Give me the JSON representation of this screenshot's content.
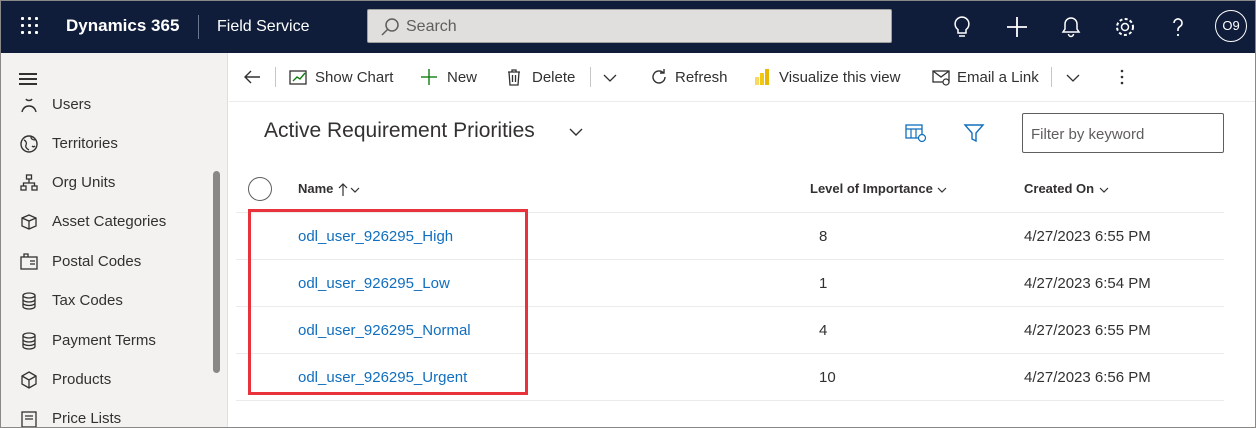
{
  "topbar": {
    "brand": "Dynamics 365",
    "app_name": "Field Service",
    "search_placeholder": "Search",
    "avatar_initials": "O9"
  },
  "sidebar": {
    "items": [
      {
        "label": "Users",
        "icon": "users-icon"
      },
      {
        "label": "Territories",
        "icon": "globe-icon"
      },
      {
        "label": "Org Units",
        "icon": "org-units-icon"
      },
      {
        "label": "Asset Categories",
        "icon": "asset-categories-icon"
      },
      {
        "label": "Postal Codes",
        "icon": "postal-codes-icon"
      },
      {
        "label": "Tax Codes",
        "icon": "database-icon"
      },
      {
        "label": "Payment Terms",
        "icon": "database-icon"
      },
      {
        "label": "Products",
        "icon": "cube-icon"
      },
      {
        "label": "Price Lists",
        "icon": "price-list-icon"
      }
    ]
  },
  "commandbar": {
    "show_chart": "Show Chart",
    "new": "New",
    "delete": "Delete",
    "refresh": "Refresh",
    "visualize": "Visualize this view",
    "email_link": "Email a Link"
  },
  "view": {
    "title": "Active Requirement Priorities",
    "filter_placeholder": "Filter by keyword"
  },
  "grid": {
    "columns": {
      "name": "Name",
      "level": "Level of Importance",
      "created": "Created On"
    },
    "rows": [
      {
        "name": "odl_user_926295_High",
        "level": "8",
        "created": "4/27/2023 6:55 PM"
      },
      {
        "name": "odl_user_926295_Low",
        "level": "1",
        "created": "4/27/2023 6:54 PM"
      },
      {
        "name": "odl_user_926295_Normal",
        "level": "4",
        "created": "4/27/2023 6:55 PM"
      },
      {
        "name": "odl_user_926295_Urgent",
        "level": "10",
        "created": "4/27/2023 6:56 PM"
      }
    ]
  },
  "colors": {
    "topbar_bg": "#0f1d3a",
    "link": "#106ebe",
    "highlight": "#e8323c"
  }
}
